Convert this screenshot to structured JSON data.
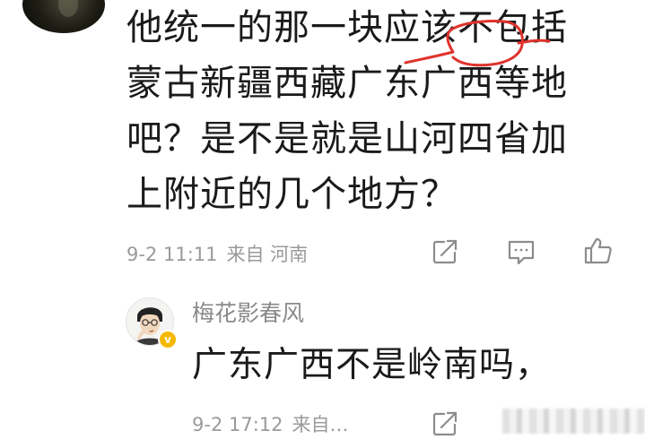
{
  "comment": {
    "lines": [
      "他统一的那一块应该不包括",
      "蒙古新疆西藏广东广西等地",
      "吧？是不是就是山河四省加",
      "上附近的几个地方？"
    ],
    "time": "9-2 11:11",
    "location": "来自 河南"
  },
  "reply": {
    "author": "梅花影春风",
    "verified_badge": "v",
    "text": "广东广西不是岭南吗，",
    "time": "9-2 17:12",
    "location": "来自…"
  },
  "icons": {
    "share": "share-icon",
    "comment": "comment-icon",
    "like": "thumbs-up-icon"
  },
  "colors": {
    "text": "#1a1a1a",
    "meta": "#9a9a9a",
    "annotation": "#e0322c",
    "badge": "#f5b800"
  }
}
